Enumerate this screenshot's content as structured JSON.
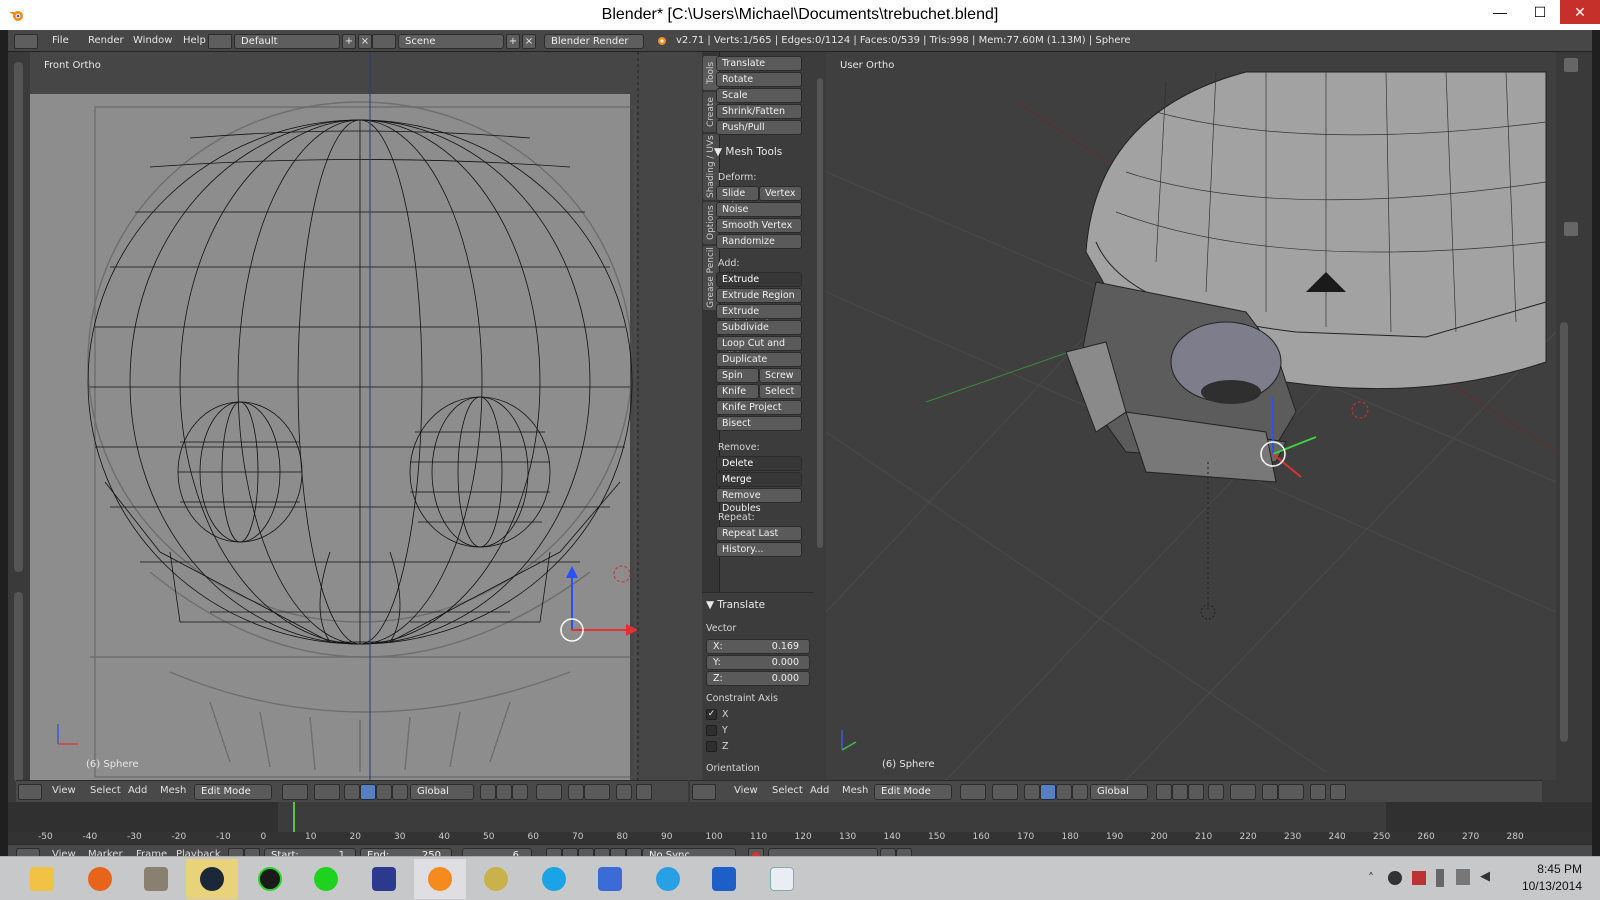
{
  "title_bar": {
    "title": "Blender* [C:\\Users\\Michael\\Documents\\trebuchet.blend]",
    "minimize": "—",
    "maximize": "☐",
    "close": "✕"
  },
  "info_header": {
    "menus": [
      "File",
      "Render",
      "Window",
      "Help"
    ],
    "layout": "Default",
    "scene": "Scene",
    "engine": "Blender Render",
    "stats": "v2.71 | Verts:1/565 | Edges:0/1124 | Faces:0/539 | Tris:998 | Mem:77.60M (1.13M) | Sphere"
  },
  "left_viewport": {
    "label": "Front Ortho",
    "object": "(6) Sphere"
  },
  "right_viewport": {
    "label": "User Ortho",
    "object": "(6) Sphere"
  },
  "tool_tabs": [
    "Tools",
    "Create",
    "Shading / UVs",
    "Options",
    "Grease Pencil"
  ],
  "tools": {
    "transform": [
      "Translate",
      "Rotate",
      "Scale",
      "Shrink/Fatten",
      "Push/Pull"
    ],
    "mesh_tools_title": "Mesh Tools",
    "deform_label": "Deform:",
    "slide_edge": "Slide Ed",
    "vertex": "Vertex",
    "noise": "Noise",
    "smooth_vertex": "Smooth Vertex",
    "randomize": "Randomize",
    "add_label": "Add:",
    "extrude": "Extrude",
    "extrude_region": "Extrude Region",
    "extrude_individual": "Extrude Individual",
    "subdivide": "Subdivide",
    "loop_cut": "Loop Cut and Slide",
    "duplicate": "Duplicate",
    "spin": "Spin",
    "screw": "Screw",
    "knife": "Knife",
    "select": "Select",
    "knife_project": "Knife Project",
    "bisect": "Bisect",
    "remove_label": "Remove:",
    "delete": "Delete",
    "merge": "Merge",
    "remove_doubles": "Remove Doubles",
    "repeat_label": "Repeat:",
    "repeat_last": "Repeat Last",
    "history": "History..."
  },
  "operator": {
    "title": "Translate",
    "vector_label": "Vector",
    "x_label": "X:",
    "x": "0.169",
    "y_label": "Y:",
    "y": "0.000",
    "z_label": "Z:",
    "z": "0.000",
    "constraint_label": "Constraint Axis",
    "cx": "X",
    "cy": "Y",
    "cz": "Z",
    "x_checked": true,
    "orientation_label": "Orientation"
  },
  "viewport_header": {
    "menus": [
      "View",
      "Select",
      "Add",
      "Mesh"
    ],
    "mode": "Edit Mode",
    "orientation": "Global"
  },
  "timeline": {
    "ticks": [
      "-50",
      "-40",
      "-30",
      "-20",
      "-10",
      "0",
      "10",
      "20",
      "30",
      "40",
      "50",
      "60",
      "70",
      "80",
      "90",
      "100",
      "110",
      "120",
      "130",
      "140",
      "150",
      "160",
      "170",
      "180",
      "190",
      "200",
      "210",
      "220",
      "230",
      "240",
      "250",
      "260",
      "270",
      "280"
    ],
    "current_frame": 6,
    "menus": [
      "View",
      "Marker",
      "Frame",
      "Playback"
    ],
    "start_label": "Start:",
    "start": "1",
    "end_label": "End:",
    "end": "250",
    "frame": "6",
    "sync": "No Sync"
  },
  "taskbar": {
    "time": "8:45 PM",
    "date": "10/13/2014"
  },
  "colors": {
    "accent": "#5680c2",
    "close": "#c7302a",
    "timeline_cursor": "#60c040"
  }
}
